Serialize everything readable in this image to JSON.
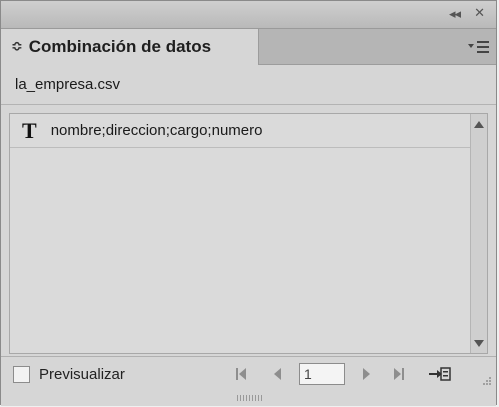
{
  "window": {
    "collapse_glyph": "◂◂",
    "close_glyph": "✕"
  },
  "tab": {
    "updown_glyph": "≎",
    "title": "Combinación de datos"
  },
  "panel_menu": {
    "icon": "panel-menu-icon"
  },
  "data_source": {
    "file_name": "la_empresa.csv"
  },
  "fields": [
    {
      "type_glyph": "T",
      "label": "nombre;direccion;cargo;numero"
    }
  ],
  "footer": {
    "preview_label": "Previsualizar",
    "preview_checked": false,
    "record_value": "1",
    "icons": {
      "first": "first-record-icon",
      "prev": "previous-record-icon",
      "next": "next-record-icon",
      "last": "last-record-icon",
      "create": "create-merged-document-icon"
    }
  },
  "colors": {
    "panel_bg": "#d6d6d6",
    "tab_bar_bg": "#b5b5b5",
    "nav_disabled": "#8e8e8e"
  }
}
